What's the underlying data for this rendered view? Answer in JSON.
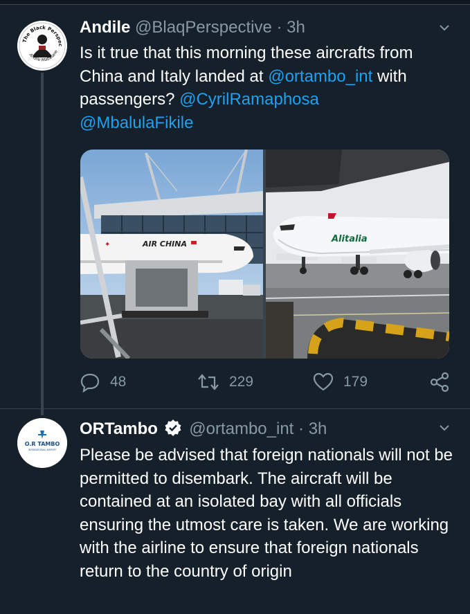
{
  "tweets": [
    {
      "name": "Andile",
      "handle": "@BlaqPerspective",
      "dot": "·",
      "time": "3h",
      "avatar_text_top": "The Black Perspective",
      "avatar_text_bottom": "Andile Mabalane",
      "text_parts": [
        {
          "t": "Is it true that this morning these aircrafts from China and Italy landed at "
        },
        {
          "t": "@ortambo_int",
          "mention": true
        },
        {
          "t": " with passengers? "
        },
        {
          "t": "@CyrilRamaphosa",
          "mention": true
        },
        {
          "t": " "
        },
        {
          "t": "@MbalulaFikile",
          "mention": true
        }
      ],
      "photos": {
        "left_livery": "AIR CHINA",
        "right_livery": "Alitalia"
      },
      "actions": {
        "replies": "48",
        "retweets": "229",
        "likes": "179"
      }
    },
    {
      "name": "ORTambo",
      "handle": "@ortambo_int",
      "dot": "·",
      "time": "3h",
      "avatar_logo_line1": "O.R TAMBO",
      "avatar_logo_line2": "INTERNATIONAL AIRPORT",
      "text": "Please be advised that foreign nationals will not be permitted to disembark. The aircraft will be contained at an isolated bay with all officials ensuring the utmost care is taken. We are working with the airline to ensure that foreign nationals return to the country of origin"
    }
  ],
  "colors": {
    "background": "#15202b",
    "secondary_text": "#8899a6",
    "link": "#1da1f2",
    "verified": "#ffffff"
  }
}
